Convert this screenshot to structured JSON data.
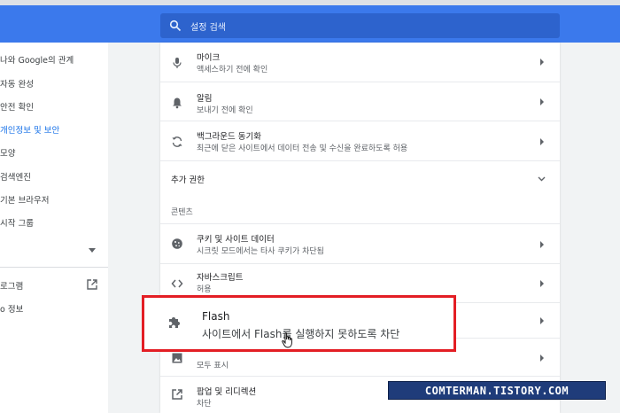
{
  "search": {
    "placeholder": "설정 검색"
  },
  "sidebar": {
    "items": [
      {
        "label": "나와 Google의 관계"
      },
      {
        "label": "자동 완성"
      },
      {
        "label": "안전 확인"
      },
      {
        "label": "개인정보 및 보안",
        "active": true
      },
      {
        "label": "모양"
      },
      {
        "label": "검색엔진"
      },
      {
        "label": "기본 브라우저"
      },
      {
        "label": "시작 그룹"
      }
    ],
    "extensions_label": "로그램",
    "about_label": "o 정보"
  },
  "content": {
    "rows": [
      {
        "title": "마이크",
        "subtitle": "액세스하기 전에 확인",
        "icon": "mic-icon"
      },
      {
        "title": "알림",
        "subtitle": "보내기 전에 확인",
        "icon": "bell-icon"
      },
      {
        "title": "백그라운드 동기화",
        "subtitle": "최근에 닫은 사이트에서 데이터 전송 및 수신을 완료하도록 허용",
        "icon": "sync-icon"
      }
    ],
    "more_permissions": "추가 권한",
    "content_section": "콘텐츠",
    "rows2": [
      {
        "title": "쿠키 및 사이트 데이터",
        "subtitle": "시크릿 모드에서는 타사 쿠키가 차단됨",
        "icon": "cookie-icon"
      },
      {
        "title": "자바스크립트",
        "subtitle": "허용",
        "icon": "code-icon"
      }
    ],
    "images_subtitle": "모두 표시",
    "popups": {
      "title": "팝업 및 리디렉션",
      "subtitle": "차단"
    }
  },
  "flash": {
    "title": "Flash",
    "subtitle": "사이트에서 Flash를 실행하지 못하도록 차단"
  },
  "watermark": "COMTERMAN.TISTORY.COM",
  "colors": {
    "header": "#3b79ec",
    "search": "#2d63cd",
    "highlight": "#e31e24",
    "active": "#1a73e8"
  }
}
